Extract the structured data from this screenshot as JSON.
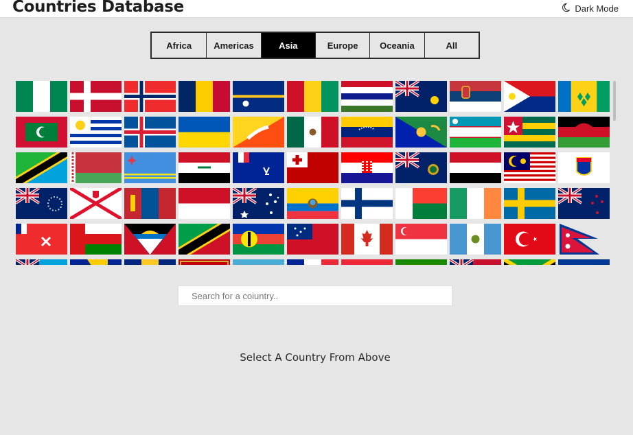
{
  "header": {
    "title": "Countries Database",
    "dark_mode_label": "Dark Mode",
    "dark_mode_icon": "moon-icon"
  },
  "regions": {
    "tabs": [
      "Africa",
      "Americas",
      "Asia",
      "Europe",
      "Oceania",
      "All"
    ],
    "active": "Asia"
  },
  "flags": [
    "Nigeria",
    "Denmark",
    "Norway",
    "Chad",
    "Nauru",
    "Guinea",
    "Gambia",
    "Turks and Caicos Islands",
    "Serbia",
    "Sint Maarten",
    "Saint Vincent and the Grenadines",
    "Maldives",
    "Uruguay",
    "Iceland",
    "Ukraine",
    "Bhutan",
    "Mexico",
    "Venezuela",
    "Christmas Island",
    "Uzbekistan",
    "Togo",
    "Malawi",
    "Tanzania",
    "Belarus",
    "Aruba",
    "Iraq",
    "French Southern Territories",
    "Tonga",
    "Croatia",
    "South Georgia",
    "Yemen",
    "Malaysia",
    "Saint Barthélemy",
    "Cook Islands",
    "Jersey",
    "Mongolia",
    "Indonesia",
    "Heard Island and McDonald Islands",
    "Ecuador",
    "Finland",
    "Madagascar",
    "Ireland",
    "Sweden",
    "New Zealand",
    "Wallis and Futuna",
    "Oman",
    "Antigua and Barbuda",
    "Saint Kitts and Nevis",
    "New Caledonia",
    "Samoa",
    "Canada",
    "Singapore",
    "Guatemala",
    "Turkey",
    "Nepal",
    "Tuvalu",
    "Bosnia and Herzegovina",
    "Barbados",
    "Montenegro",
    "Palau",
    "France",
    "Austria",
    "Zambia",
    "Bermuda",
    "Jamaica",
    "Marshall Islands"
  ],
  "search": {
    "placeholder": "Search for a coiuntry.."
  },
  "main": {
    "prompt": "Select A Country From Above"
  },
  "colors": {
    "background": "#e6e6e6",
    "active_tab": "#000000",
    "header_bg": "#ffffff"
  }
}
